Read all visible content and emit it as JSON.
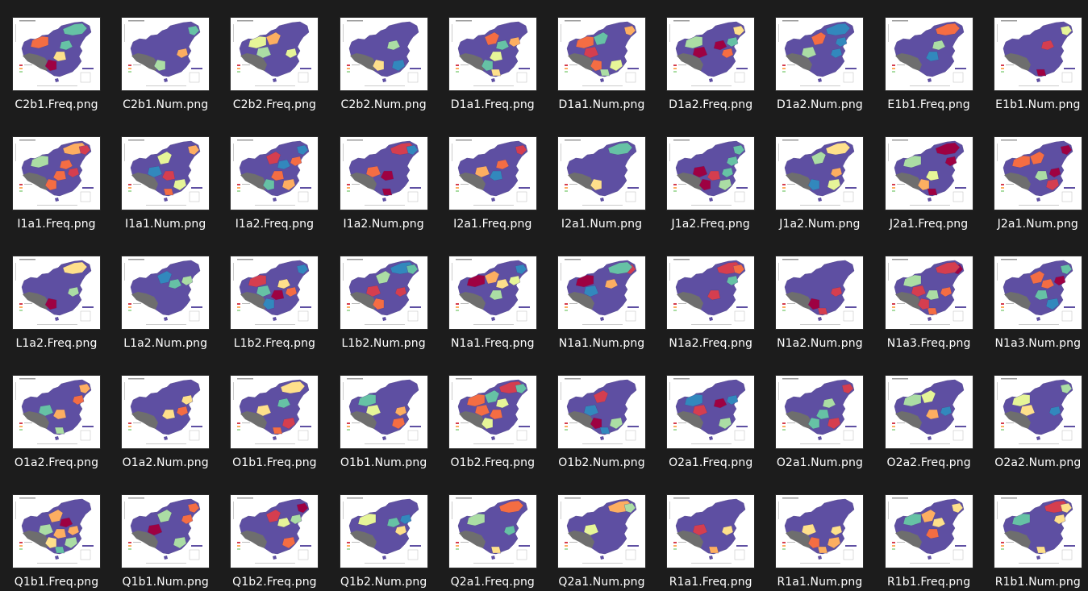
{
  "colors": {
    "background": "#1c1c1c",
    "label_text": "#ffffff",
    "thumb_bg": "#ffffff",
    "map_base": "#5e4fa2",
    "map_nodata": "#6e6e6e",
    "accents": [
      "#9e0142",
      "#d53e4f",
      "#f46d43",
      "#fdae61",
      "#fee08b",
      "#e6f598",
      "#abdda4",
      "#66c2a5",
      "#3288bd"
    ]
  },
  "files": [
    {
      "name": "C2b1.Freq.png",
      "thumbnail": "heatmap-thumbnail"
    },
    {
      "name": "C2b1.Num.png",
      "thumbnail": "heatmap-thumbnail"
    },
    {
      "name": "C2b2.Freq.png",
      "thumbnail": "heatmap-thumbnail"
    },
    {
      "name": "C2b2.Num.png",
      "thumbnail": "heatmap-thumbnail"
    },
    {
      "name": "D1a1.Freq.png",
      "thumbnail": "heatmap-thumbnail"
    },
    {
      "name": "D1a1.Num.png",
      "thumbnail": "heatmap-thumbnail"
    },
    {
      "name": "D1a2.Freq.png",
      "thumbnail": "heatmap-thumbnail"
    },
    {
      "name": "D1a2.Num.png",
      "thumbnail": "heatmap-thumbnail"
    },
    {
      "name": "E1b1.Freq.png",
      "thumbnail": "heatmap-thumbnail"
    },
    {
      "name": "E1b1.Num.png",
      "thumbnail": "heatmap-thumbnail"
    },
    {
      "name": "I1a1.Freq.png",
      "thumbnail": "heatmap-thumbnail"
    },
    {
      "name": "I1a1.Num.png",
      "thumbnail": "heatmap-thumbnail"
    },
    {
      "name": "I1a2.Freq.png",
      "thumbnail": "heatmap-thumbnail"
    },
    {
      "name": "I1a2.Num.png",
      "thumbnail": "heatmap-thumbnail"
    },
    {
      "name": "I2a1.Freq.png",
      "thumbnail": "heatmap-thumbnail"
    },
    {
      "name": "I2a1.Num.png",
      "thumbnail": "heatmap-thumbnail"
    },
    {
      "name": "J1a2.Freq.png",
      "thumbnail": "heatmap-thumbnail"
    },
    {
      "name": "J1a2.Num.png",
      "thumbnail": "heatmap-thumbnail"
    },
    {
      "name": "J2a1.Freq.png",
      "thumbnail": "heatmap-thumbnail"
    },
    {
      "name": "J2a1.Num.png",
      "thumbnail": "heatmap-thumbnail"
    },
    {
      "name": "L1a2.Freq.png",
      "thumbnail": "heatmap-thumbnail"
    },
    {
      "name": "L1a2.Num.png",
      "thumbnail": "heatmap-thumbnail"
    },
    {
      "name": "L1b2.Freq.png",
      "thumbnail": "heatmap-thumbnail"
    },
    {
      "name": "L1b2.Num.png",
      "thumbnail": "heatmap-thumbnail"
    },
    {
      "name": "N1a1.Freq.png",
      "thumbnail": "heatmap-thumbnail"
    },
    {
      "name": "N1a1.Num.png",
      "thumbnail": "heatmap-thumbnail"
    },
    {
      "name": "N1a2.Freq.png",
      "thumbnail": "heatmap-thumbnail"
    },
    {
      "name": "N1a2.Num.png",
      "thumbnail": "heatmap-thumbnail"
    },
    {
      "name": "N1a3.Freq.png",
      "thumbnail": "heatmap-thumbnail"
    },
    {
      "name": "N1a3.Num.png",
      "thumbnail": "heatmap-thumbnail"
    },
    {
      "name": "O1a2.Freq.png",
      "thumbnail": "heatmap-thumbnail"
    },
    {
      "name": "O1a2.Num.png",
      "thumbnail": "heatmap-thumbnail"
    },
    {
      "name": "O1b1.Freq.png",
      "thumbnail": "heatmap-thumbnail"
    },
    {
      "name": "O1b1.Num.png",
      "thumbnail": "heatmap-thumbnail"
    },
    {
      "name": "O1b2.Freq.png",
      "thumbnail": "heatmap-thumbnail"
    },
    {
      "name": "O1b2.Num.png",
      "thumbnail": "heatmap-thumbnail"
    },
    {
      "name": "O2a1.Freq.png",
      "thumbnail": "heatmap-thumbnail"
    },
    {
      "name": "O2a1.Num.png",
      "thumbnail": "heatmap-thumbnail"
    },
    {
      "name": "O2a2.Freq.png",
      "thumbnail": "heatmap-thumbnail"
    },
    {
      "name": "O2a2.Num.png",
      "thumbnail": "heatmap-thumbnail"
    },
    {
      "name": "Q1b1.Freq.png",
      "thumbnail": "heatmap-thumbnail"
    },
    {
      "name": "Q1b1.Num.png",
      "thumbnail": "heatmap-thumbnail"
    },
    {
      "name": "Q1b2.Freq.png",
      "thumbnail": "heatmap-thumbnail"
    },
    {
      "name": "Q1b2.Num.png",
      "thumbnail": "heatmap-thumbnail"
    },
    {
      "name": "Q2a1.Freq.png",
      "thumbnail": "heatmap-thumbnail"
    },
    {
      "name": "Q2a1.Num.png",
      "thumbnail": "heatmap-thumbnail"
    },
    {
      "name": "R1a1.Freq.png",
      "thumbnail": "heatmap-thumbnail"
    },
    {
      "name": "R1a1.Num.png",
      "thumbnail": "heatmap-thumbnail"
    },
    {
      "name": "R1b1.Freq.png",
      "thumbnail": "heatmap-thumbnail"
    },
    {
      "name": "R1b1.Num.png",
      "thumbnail": "heatmap-thumbnail"
    }
  ]
}
